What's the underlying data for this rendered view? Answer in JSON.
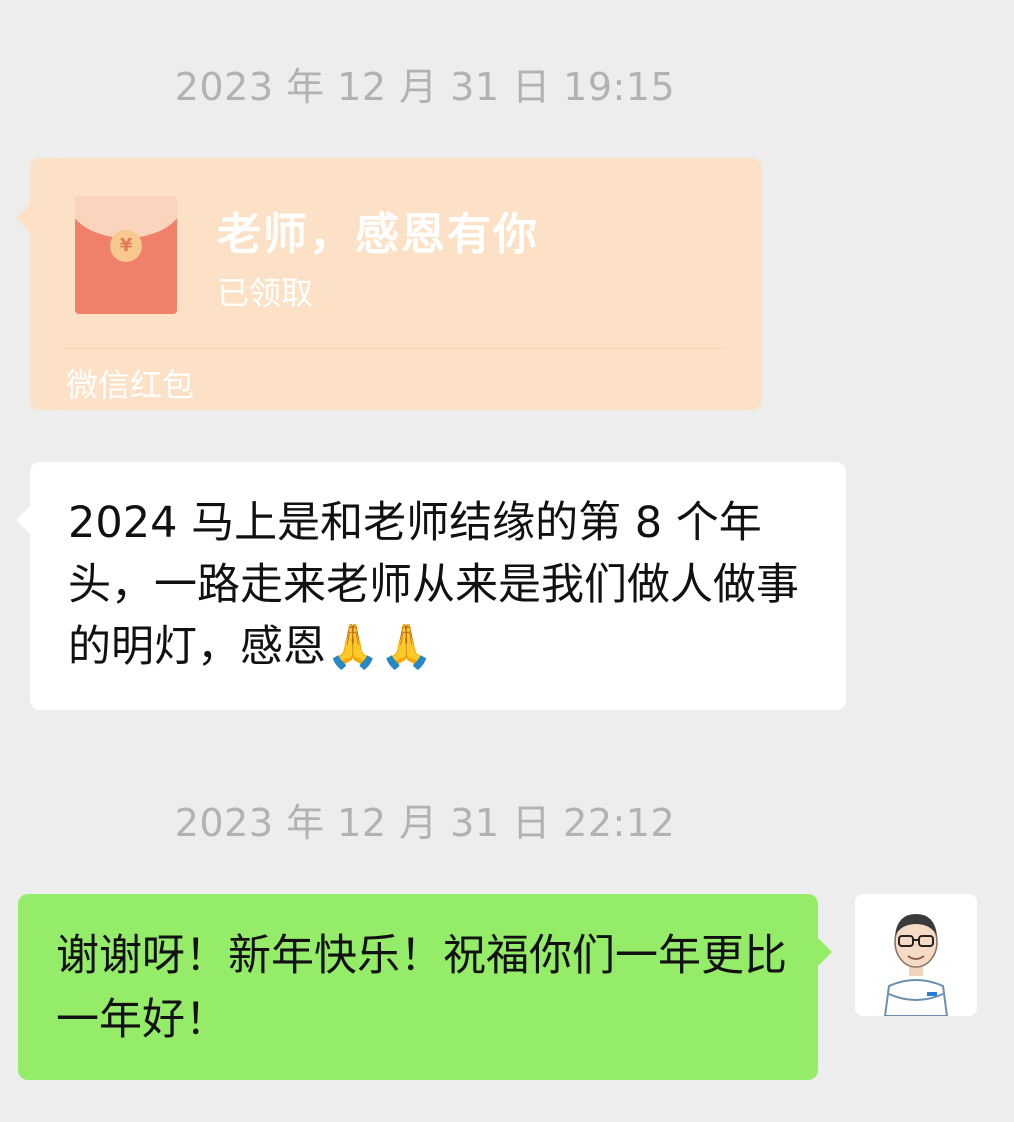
{
  "messages": {
    "timestamp1": "2023 年 12 月 31 日 19:15",
    "red_packet": {
      "title": "老师，感恩有你",
      "status": "已领取",
      "footer": "微信红包"
    },
    "incoming_text": "2024 马上是和老师结缘的第 8 个年头，一路走来老师从来是我们做人做事的明灯，感恩🙏🙏",
    "timestamp2": "2023 年 12 月 31 日 22:12",
    "outgoing_text": "谢谢呀！新年快乐！祝福你们一年更比一年好！"
  },
  "colors": {
    "background": "#ededed",
    "red_packet_bg": "#fce1c6",
    "incoming_bubble": "#ffffff",
    "outgoing_bubble": "#95ec69",
    "timestamp_text": "#b2b2b2"
  },
  "icons": {
    "red_packet_icon": "red-envelope-icon",
    "avatar": "teacher-avatar"
  }
}
